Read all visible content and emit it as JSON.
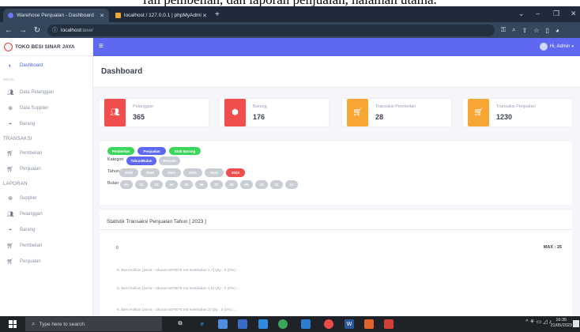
{
  "caption": "ran pembelian, dan laporan penjualan, halaman utama.",
  "browser": {
    "tabs": [
      {
        "label": "Warehose Penjualan - Dashboard",
        "active": true
      },
      {
        "label": "localhost / 127.0.0.1 | phpMyAdmi",
        "active": false
      }
    ],
    "url_host": "localhost",
    "url_path": "/asw/"
  },
  "app": {
    "brand": "TOKO BESI SINAR JAYA",
    "user_label": "Hi, Admin"
  },
  "sidebar": {
    "dashboard": "Dashboard",
    "menu_caption": "MENU",
    "menu_items": [
      "Data Pelanggan",
      "Data Supplier",
      "Barang"
    ],
    "transaksi_header": "TRANSAKSI",
    "transaksi_items": [
      "Pembelian",
      "Penjualan"
    ],
    "laporan_header": "LAPORAN",
    "laporan_items": [
      "Supplier",
      "Pelanggan",
      "Barang",
      "Pembelian",
      "Penjualan"
    ]
  },
  "page": {
    "title": "Dashboard"
  },
  "stats": [
    {
      "label": "Pelanggan",
      "value": "365",
      "color": "#f04d4d",
      "icon": "users-icon"
    },
    {
      "label": "Barang",
      "value": "176",
      "color": "#f04d4d",
      "icon": "box-icon"
    },
    {
      "label": "Transaksi Pembelian",
      "value": "28",
      "color": "#f7a534",
      "icon": "cart-icon"
    },
    {
      "label": "Transaksi Penjualan",
      "value": "1230",
      "color": "#f7a534",
      "icon": "cart-icon"
    }
  ],
  "filters": {
    "mode_buttons": [
      {
        "label": "Pembelian",
        "color": "#3dd65c"
      },
      {
        "label": "Penjualan",
        "color": "#5f68f0"
      },
      {
        "label": "Stok Barang",
        "color": "#3dd65c"
      }
    ],
    "kategori_label": "Kategori",
    "kategori_options": [
      {
        "label": "Tahun/Bulan",
        "selected": true
      },
      {
        "label": "Periode",
        "selected": false
      }
    ],
    "tahun_label": "Tahun",
    "years": [
      {
        "label": "2019",
        "selected": false
      },
      {
        "label": "2020",
        "selected": false
      },
      {
        "label": "2021",
        "selected": false
      },
      {
        "label": "2021",
        "selected": false
      },
      {
        "label": "2022",
        "selected": false
      },
      {
        "label": "2023",
        "selected": true
      }
    ],
    "bulan_label": "Bulan",
    "months": [
      "01",
      "02",
      "03",
      "04",
      "05",
      "06",
      "07",
      "08",
      "09",
      "10",
      "11",
      "12"
    ]
  },
  "statistics": {
    "title": "Statistik Transaksi Penjualan Tahun [ 2023 ]",
    "zero_label": "0",
    "max_label": "MAX : 25",
    "items": [
      "6.  Besi Hollow   [Jenis:-  Ukuran:60*60*6 mtr  Ketebalan:1.7]   Qty : 0 (0%) :..",
      "6.  Besi Hollow   [Jenis:-  Ukuran:60*60*6 mtr  Ketebalan:1.8]   Qty : 0 (0%) :..",
      "6.  Besi Hollow   [Jenis:-  Ukuran:60*60*6 mtr  Ketebalan:2]   Qty : 0 (0%) :.."
    ]
  },
  "taskbar": {
    "search_placeholder": "Type here to search",
    "time": "16:35",
    "date": "21/05/2023"
  }
}
